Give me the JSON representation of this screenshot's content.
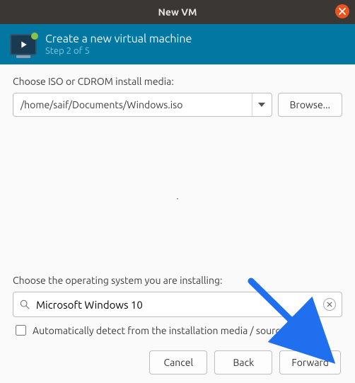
{
  "titlebar": {
    "title": "New VM"
  },
  "banner": {
    "heading": "Create a new virtual machine",
    "step": "Step 2 of 5"
  },
  "media": {
    "label": "Choose ISO or CDROM install media:",
    "path": "/home/saif/Documents/Windows.iso",
    "browse": "Browse..."
  },
  "os": {
    "label": "Choose the operating system you are installing:",
    "value": "Microsoft Windows 10",
    "autodetect": "Automatically detect from the installation media / source"
  },
  "buttons": {
    "cancel": "Cancel",
    "back": "Back",
    "forward": "Forward"
  }
}
